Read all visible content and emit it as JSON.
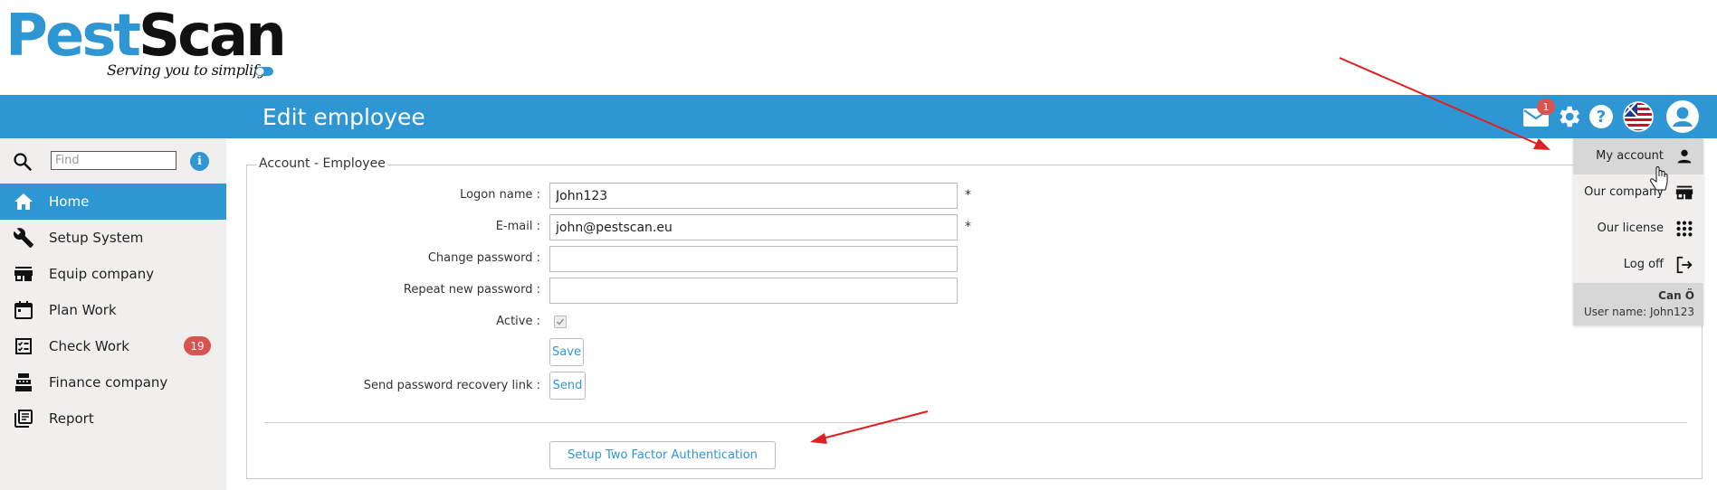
{
  "logo": {
    "part1": "Pest",
    "part2": "Scan",
    "tagline": "Serving you to simplify"
  },
  "header": {
    "title": "Edit employee",
    "mail_count": "1"
  },
  "sidebar": {
    "search_placeholder": "Find",
    "items": [
      {
        "label": "Home",
        "icon": "home-icon"
      },
      {
        "label": "Setup System",
        "icon": "wrench-icon"
      },
      {
        "label": "Equip company",
        "icon": "store-icon"
      },
      {
        "label": "Plan Work",
        "icon": "calendar-icon"
      },
      {
        "label": "Check Work",
        "icon": "checklist-icon",
        "badge": "19"
      },
      {
        "label": "Finance company",
        "icon": "cash-register-icon"
      },
      {
        "label": "Report",
        "icon": "report-icon"
      }
    ]
  },
  "form": {
    "legend": "Account - Employee",
    "logon_label": "Logon name :",
    "logon_value": "John123",
    "email_label": "E-mail :",
    "email_value": "john@pestscan.eu",
    "change_pw_label": "Change password :",
    "repeat_pw_label": "Repeat new password :",
    "active_label": "Active :",
    "required_mark": "*",
    "save_label": "Save",
    "recovery_label": "Send password recovery link :",
    "send_label": "Send",
    "twofactor_label": "Setup Two Factor Authentication"
  },
  "account_menu": {
    "items": [
      {
        "label": "My account",
        "icon": "person-icon"
      },
      {
        "label": "Our company",
        "icon": "store-icon"
      },
      {
        "label": "Our license",
        "icon": "grid-icon"
      },
      {
        "label": "Log off",
        "icon": "logout-icon"
      }
    ],
    "user_display": "Can Ö",
    "user_login": "User name: John123"
  },
  "colors": {
    "accent": "#2e96d3",
    "badge": "#d9534f",
    "sidebar_bg": "#f0efee",
    "annotation": "#e02020"
  }
}
